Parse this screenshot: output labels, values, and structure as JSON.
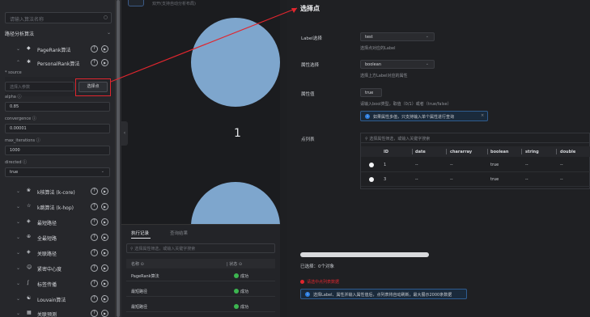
{
  "sidebar": {
    "search_placeholder": "请输入算法名称",
    "section_title": "路径分析算法",
    "algorithms": [
      {
        "name": "PageRank算法",
        "icon": "pagerank-icon",
        "expanded": false
      },
      {
        "name": "PersonalRank算法",
        "icon": "personalrank-icon",
        "expanded": true
      },
      {
        "name": "k核算法 (k-core)",
        "icon": "kcore-icon",
        "expanded": false
      },
      {
        "name": "k跳算法 (k-hop)",
        "icon": "khop-icon",
        "expanded": false
      },
      {
        "name": "最短路径",
        "icon": "shortest-path-icon",
        "expanded": false
      },
      {
        "name": "全最短路",
        "icon": "all-shortest-path-icon",
        "expanded": false
      },
      {
        "name": "关联路径",
        "icon": "related-path-icon",
        "expanded": false
      },
      {
        "name": "紧密中心度",
        "icon": "closeness-icon",
        "expanded": false
      },
      {
        "name": "标签传播",
        "icon": "label-propagation-icon",
        "expanded": false
      },
      {
        "name": "Louvain算法",
        "icon": "louvain-icon",
        "expanded": false
      },
      {
        "name": "关联预测",
        "icon": "link-prediction-icon",
        "expanded": false
      }
    ],
    "params": {
      "source_label": "* source",
      "source_placeholder": "选择入参数",
      "select_button": "选择点",
      "alpha_label": "alpha",
      "alpha_value": "0.85",
      "convergence_label": "convergence",
      "convergence_value": "0.00001",
      "max_iterations_label": "max_iterations",
      "max_iterations_value": "1000",
      "directed_label": "directed",
      "directed_value": "true"
    }
  },
  "canvas": {
    "top_text": "双开(支持自动分析布局)",
    "node_label": "1"
  },
  "bottom": {
    "tab_active": "执行记录",
    "tab_inactive": "查询结果",
    "search_placeholder": "选择属性筛选，或输入关键字搜索",
    "col_name": "名称",
    "col_status": "状态",
    "rows": [
      {
        "name": "PageRank算法",
        "status": "成功"
      },
      {
        "name": "最短路径",
        "status": "成功"
      },
      {
        "name": "最短路径",
        "status": "成功"
      }
    ]
  },
  "panel": {
    "title": "选择点",
    "label_field": "Label选择",
    "label_value": "test",
    "label_hint": "选择点对应的Label",
    "prop_field": "属性选择",
    "prop_value": "boolean",
    "prop_hint": "选择上方Label对应的属性",
    "val_field": "属性值",
    "val_value": "true",
    "val_hint": "请输入bool类型，取值（0/1）或者（true/false）",
    "info1": "如果属性多值，只支持输入单个属性进行查询",
    "list_field": "点列表",
    "list_search": "选择属性筛选，或输入关键字搜索",
    "columns": [
      "ID",
      "date",
      "chararray",
      "boolean",
      "string",
      "double"
    ],
    "rows": [
      [
        "1",
        "--",
        "--",
        "true",
        "--",
        "--"
      ],
      [
        "3",
        "--",
        "--",
        "true",
        "--",
        "--"
      ]
    ],
    "selected_text": "已选择：0个对象",
    "error_text": "请选中点列表数据",
    "info2": "选择Label、属性并输入属性值后，点列表将自动刷新，最大展示2000条数据"
  }
}
